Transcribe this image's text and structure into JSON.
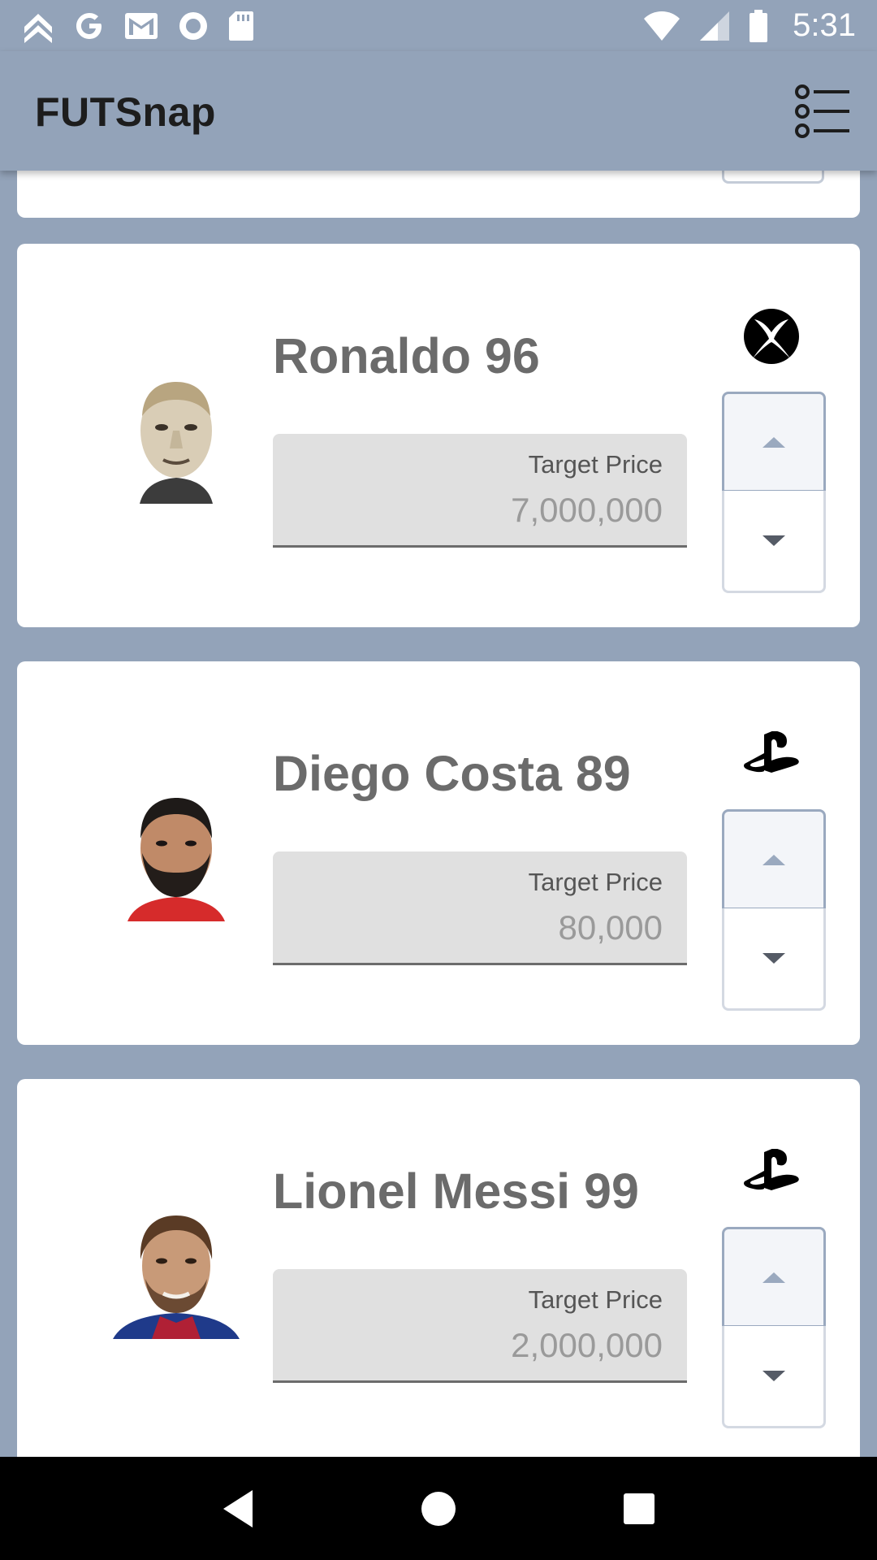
{
  "status_bar": {
    "time": "5:31",
    "left_icons": [
      "chevrons-up-icon",
      "google-icon",
      "gmail-icon",
      "record-icon",
      "sd-card-icon"
    ],
    "right_icons": [
      "wifi-icon",
      "signal-icon",
      "battery-icon"
    ]
  },
  "app_bar": {
    "title": "FUTSnap",
    "menu_icon": "list-menu-icon"
  },
  "players": [
    {
      "name": "Ronaldo 96",
      "platform": "xbox-icon",
      "price_label": "Target Price",
      "price_value": "7,000,000"
    },
    {
      "name": "Diego Costa 89",
      "platform": "playstation-icon",
      "price_label": "Target Price",
      "price_value": "80,000"
    },
    {
      "name": "Lionel Messi 99",
      "platform": "playstation-icon",
      "price_label": "Target Price",
      "price_value": "2,000,000"
    }
  ],
  "nav_bar": {
    "icons": [
      "back-icon",
      "home-icon",
      "recents-icon"
    ]
  },
  "colors": {
    "background": "#93a3b9",
    "card": "#ffffff",
    "name_text": "#6b6b6b",
    "price_field": "#e0e0e0",
    "stepper_border": "#9aa9bf"
  }
}
